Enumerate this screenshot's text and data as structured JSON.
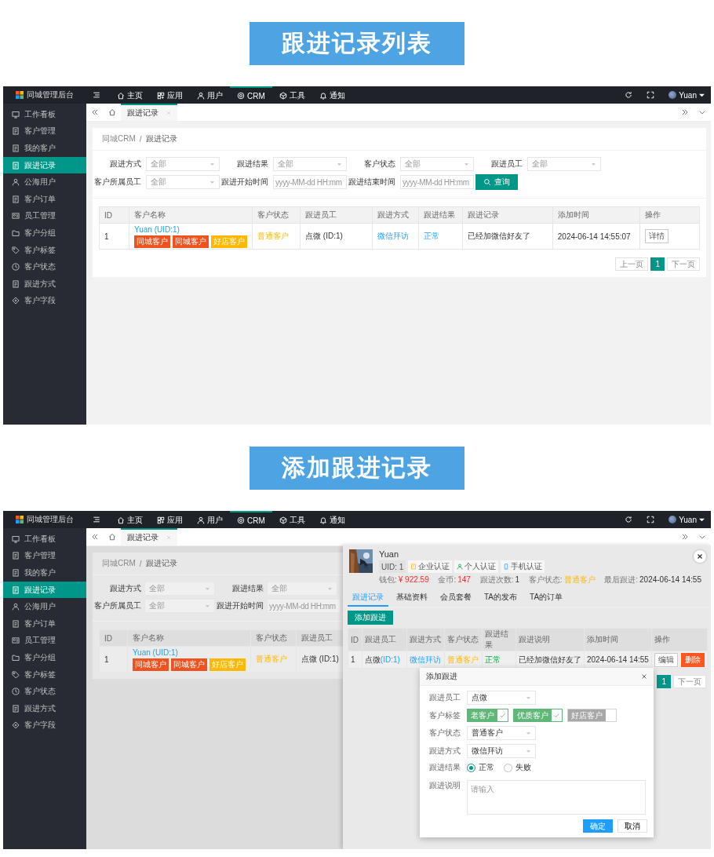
{
  "screens": [
    {
      "banner": "跟进记录列表",
      "logo": "同城管理后台",
      "nav": [
        {
          "label": "主页",
          "selected": false
        },
        {
          "label": "应用",
          "selected": false
        },
        {
          "label": "用户",
          "selected": false
        },
        {
          "label": "CRM",
          "selected": true
        },
        {
          "label": "工具",
          "selected": false
        },
        {
          "label": "通知",
          "selected": false
        }
      ],
      "user": "Yuan",
      "sidebar": [
        {
          "label": "工作看板",
          "selected": false
        },
        {
          "label": "客户管理",
          "selected": false
        },
        {
          "label": "我的客户",
          "selected": false
        },
        {
          "label": "跟进记录",
          "selected": true
        },
        {
          "label": "公海用户",
          "selected": false
        },
        {
          "label": "客户订单",
          "selected": false
        },
        {
          "label": "员工管理",
          "selected": false
        },
        {
          "label": "客户分组",
          "selected": false
        },
        {
          "label": "客户标签",
          "selected": false
        },
        {
          "label": "客户状态",
          "selected": false
        },
        {
          "label": "跟进方式",
          "selected": false
        },
        {
          "label": "客户字段",
          "selected": false
        }
      ],
      "tab": "跟进记录",
      "breadcrumb": [
        "同城CRM",
        "跟进记录"
      ],
      "breadcrumb_separator": "/",
      "filter_rows": [
        [
          {
            "kind": "select",
            "label": "跟进方式",
            "placeholder": "全部"
          },
          {
            "kind": "select",
            "label": "跟进结果",
            "placeholder": "全部"
          },
          {
            "kind": "select",
            "label": "客户状态",
            "placeholder": "全部"
          },
          {
            "kind": "select",
            "label": "跟进员工",
            "placeholder": "全部"
          }
        ],
        [
          {
            "kind": "select",
            "label": "客户所属员工",
            "placeholder": "全部"
          },
          {
            "kind": "date",
            "label": "跟进开始时间",
            "placeholder": "yyyy-MM-dd HH:mm"
          },
          {
            "kind": "date",
            "label": "跟进结束时间",
            "placeholder": "yyyy-MM-dd HH:mm"
          },
          {
            "kind": "button",
            "label": "查询"
          }
        ]
      ],
      "table": {
        "columns": [
          "ID",
          "客户名称",
          "客户状态",
          "跟进员工",
          "跟进方式",
          "跟进结果",
          "跟进记录",
          "添加时间",
          "操作"
        ],
        "rows": [
          {
            "cells": [
              {
                "kind": "text",
                "text": "1"
              },
              {
                "kind": "customer",
                "name": "Yuan (UID:1)",
                "tags": [
                  {
                    "label": "同城客户",
                    "color": "#f0521f"
                  },
                  {
                    "label": "同城客户",
                    "color": "#f0521f"
                  },
                  {
                    "label": "好店客户",
                    "color": "#ffb800"
                  }
                ]
              },
              {
                "kind": "status",
                "text": "普通客户"
              },
              {
                "kind": "text",
                "text": "点微 (ID:1)"
              },
              {
                "kind": "link",
                "text": "微信拜访"
              },
              {
                "kind": "link",
                "text": "正常"
              },
              {
                "kind": "text",
                "text": "已经加微信好友了"
              },
              {
                "kind": "text",
                "text": "2024-06-14 14:55:07"
              },
              {
                "kind": "actions",
                "actions": [
                  {
                    "kind": "plain",
                    "label": "详情"
                  }
                ]
              }
            ]
          }
        ]
      },
      "pagination": {
        "prev": "上一页",
        "pages": [
          {
            "label": "1",
            "selected": true
          }
        ],
        "next": "下一页"
      }
    },
    {
      "banner": "添加跟进记录",
      "logo": "同城管理后台",
      "nav": [
        {
          "label": "主页",
          "selected": false
        },
        {
          "label": "应用",
          "selected": false
        },
        {
          "label": "用户",
          "selected": false
        },
        {
          "label": "CRM",
          "selected": true
        },
        {
          "label": "工具",
          "selected": false
        },
        {
          "label": "通知",
          "selected": false
        }
      ],
      "user": "Yuan",
      "sidebar": [
        {
          "label": "工作看板",
          "selected": false
        },
        {
          "label": "客户管理",
          "selected": false
        },
        {
          "label": "我的客户",
          "selected": false
        },
        {
          "label": "跟进记录",
          "selected": true
        },
        {
          "label": "公海用户",
          "selected": false
        },
        {
          "label": "客户订单",
          "selected": false
        },
        {
          "label": "员工管理",
          "selected": false
        },
        {
          "label": "客户分组",
          "selected": false
        },
        {
          "label": "客户标签",
          "selected": false
        },
        {
          "label": "客户状态",
          "selected": false
        },
        {
          "label": "跟进方式",
          "selected": false
        },
        {
          "label": "客户字段",
          "selected": false
        }
      ],
      "tab": "跟进记录",
      "breadcrumb": [
        "同城CRM",
        "跟进记录"
      ],
      "breadcrumb_separator": "/",
      "filter_rows": [
        [
          {
            "kind": "select",
            "label": "跟进方式",
            "placeholder": "全部"
          },
          {
            "kind": "select",
            "label": "跟进结果",
            "placeholder": "全部"
          }
        ],
        [
          {
            "kind": "select",
            "label": "客户所属员工",
            "placeholder": "全部"
          },
          {
            "kind": "date",
            "label": "跟进开始时间",
            "placeholder": "yyyy-MM-dd HH:mm"
          }
        ]
      ],
      "table": {
        "columns": [
          "ID",
          "客户名称",
          "客户状态",
          "跟进员工"
        ],
        "rows": [
          {
            "cells": [
              {
                "kind": "text",
                "text": "1"
              },
              {
                "kind": "customer",
                "name": "Yuan (UID:1)",
                "tags": [
                  {
                    "label": "同城客户",
                    "color": "#f0521f"
                  },
                  {
                    "label": "同城客户",
                    "color": "#f0521f"
                  },
                  {
                    "label": "好店客户",
                    "color": "#ffb800"
                  }
                ]
              },
              {
                "kind": "status",
                "text": "普通客户"
              },
              {
                "kind": "text",
                "text": "点微 (ID:1)"
              }
            ]
          }
        ]
      },
      "drawer": {
        "name": "Yuan",
        "badges": [
          {
            "kind": "uid",
            "label": "UID: 1"
          },
          {
            "kind": "company",
            "label": "企业认证"
          },
          {
            "kind": "person",
            "label": "个人认证"
          },
          {
            "kind": "phone",
            "label": "手机认证"
          }
        ],
        "stats": [
          {
            "kind": "money",
            "label": "钱包:",
            "value": "¥ 922.59"
          },
          {
            "kind": "money",
            "label": "金币:",
            "value": "147"
          },
          {
            "kind": "plain",
            "label": "跟进次数:",
            "value": "1"
          },
          {
            "kind": "status",
            "label": "客户状态:",
            "value": "普通客户"
          },
          {
            "kind": "plain",
            "label": "最后跟进:",
            "value": "2024-06-14 14:55"
          }
        ],
        "tabs": [
          {
            "label": "跟进记录",
            "selected": true
          },
          {
            "label": "基础资料",
            "selected": false
          },
          {
            "label": "会员套餐",
            "selected": false
          },
          {
            "label": "TA的发布",
            "selected": false
          },
          {
            "label": "TA的订单",
            "selected": false
          }
        ],
        "add_button": "添加跟进",
        "table": {
          "columns": [
            "ID",
            "跟进员工",
            "跟进方式",
            "客户状态",
            "跟进结果",
            "跟进说明",
            "添加时间",
            "操作"
          ],
          "rows": [
            {
              "cells": [
                {
                  "kind": "text",
                  "text": "1"
                },
                {
                  "kind": "staff",
                  "name": "点微",
                  "id": "(ID:1)"
                },
                {
                  "kind": "link",
                  "text": "微信拜访"
                },
                {
                  "kind": "status",
                  "text": "普通客户"
                },
                {
                  "kind": "success",
                  "text": "正常"
                },
                {
                  "kind": "text",
                  "text": "已经加微信好友了"
                },
                {
                  "kind": "text",
                  "text": "2024-06-14 14:55"
                },
                {
                  "kind": "actions",
                  "actions": [
                    {
                      "kind": "plain",
                      "label": "编辑"
                    },
                    {
                      "kind": "danger",
                      "label": "删除"
                    }
                  ]
                }
              ]
            }
          ]
        },
        "pagination": {
          "pages": [
            {
              "label": "1",
              "selected": true
            }
          ],
          "next": "下一页"
        }
      },
      "dialog": {
        "title": "添加跟进",
        "fields": [
          {
            "kind": "select",
            "label": "跟进员工",
            "value": "点微"
          },
          {
            "kind": "tags",
            "label": "客户标签",
            "options": [
              {
                "label": "老客户",
                "checked": true
              },
              {
                "label": "优质客户",
                "checked": true
              },
              {
                "label": "好店客户",
                "checked": false
              }
            ]
          },
          {
            "kind": "select",
            "label": "客户状态",
            "value": "普通客户"
          },
          {
            "kind": "select",
            "label": "跟进方式",
            "value": "微信拜访"
          },
          {
            "kind": "radio",
            "label": "跟进结果",
            "options": [
              {
                "label": "正常",
                "selected": true
              },
              {
                "label": "失败",
                "selected": false
              }
            ]
          },
          {
            "kind": "textarea",
            "label": "跟进说明",
            "placeholder": "请输入"
          }
        ],
        "buttons": [
          {
            "kind": "primary",
            "label": "确定"
          },
          {
            "kind": "plain",
            "label": "取消"
          }
        ]
      }
    }
  ]
}
